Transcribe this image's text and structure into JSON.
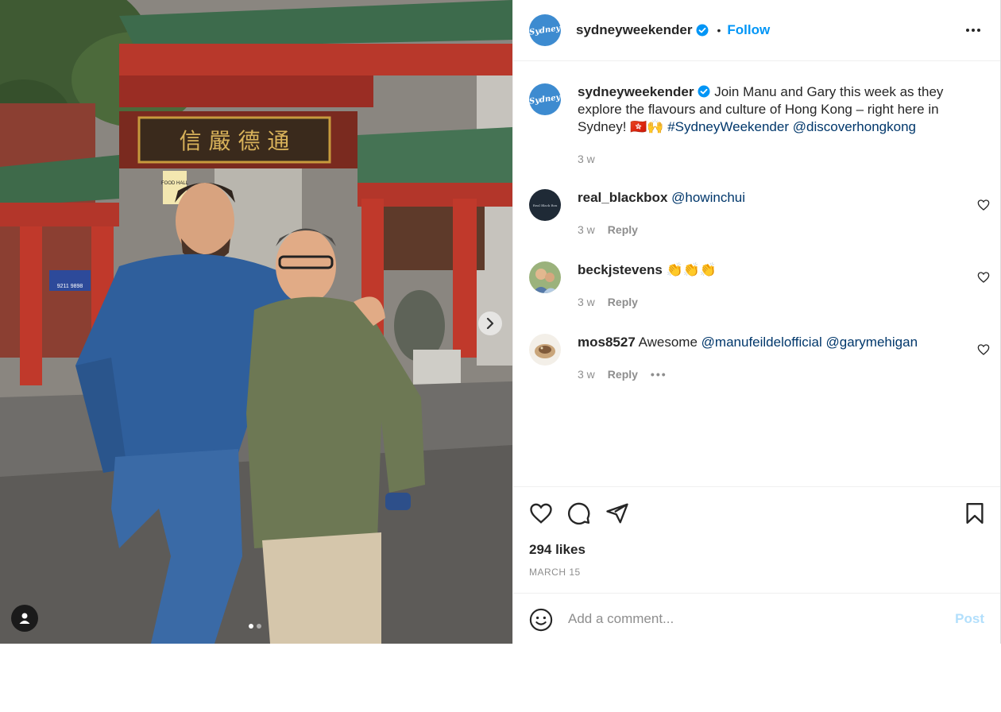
{
  "post": {
    "username": "sydneyweekender",
    "follow_label": "Follow",
    "separator": "•",
    "avatar_text": "Sydney",
    "caption_text": "Join Manu and Gary this week as they explore the flavours and culture of Hong Kong – right here in Sydney! 🇭🇰🙌",
    "caption_hashtag": "#SydneyWeekender",
    "caption_mention": "@discoverhongkong",
    "caption_time": "3 w",
    "likes": "294 likes",
    "date": "MARCH 15"
  },
  "photo": {
    "sign_text": "信 嚴 德 通",
    "small_sign": "FOOD HALL",
    "phone_sign": "9211 9898",
    "carousel_dots": 2,
    "active_dot": 0
  },
  "comments": [
    {
      "username": "real_blackbox",
      "text": "",
      "mention": "@howinchui",
      "mention2": "",
      "time": "3 w",
      "reply_label": "Reply",
      "avatar_text": "Real Black Box"
    },
    {
      "username": "beckjstevens",
      "text": "👏👏👏",
      "mention": "",
      "mention2": "",
      "time": "3 w",
      "reply_label": "Reply",
      "avatar_text": ""
    },
    {
      "username": "mos8527",
      "text": "Awesome",
      "mention": "@manufeildelofficial",
      "mention2": "@garymehigan",
      "time": "3 w",
      "reply_label": "Reply",
      "more_label": "•••",
      "avatar_text": ""
    }
  ],
  "composer": {
    "placeholder": "Add a comment...",
    "post_label": "Post"
  },
  "colors": {
    "accent": "#0095f6",
    "link": "#00376b",
    "muted": "#8e8e8e",
    "post_disabled": "#b2dffc",
    "brand_avatar": "#3d8bd0"
  },
  "icons": [
    "more-icon",
    "verified-icon",
    "heart-icon",
    "comment-icon",
    "share-icon",
    "save-icon",
    "emoji-icon",
    "chevron-right-icon",
    "user-tag-icon"
  ]
}
